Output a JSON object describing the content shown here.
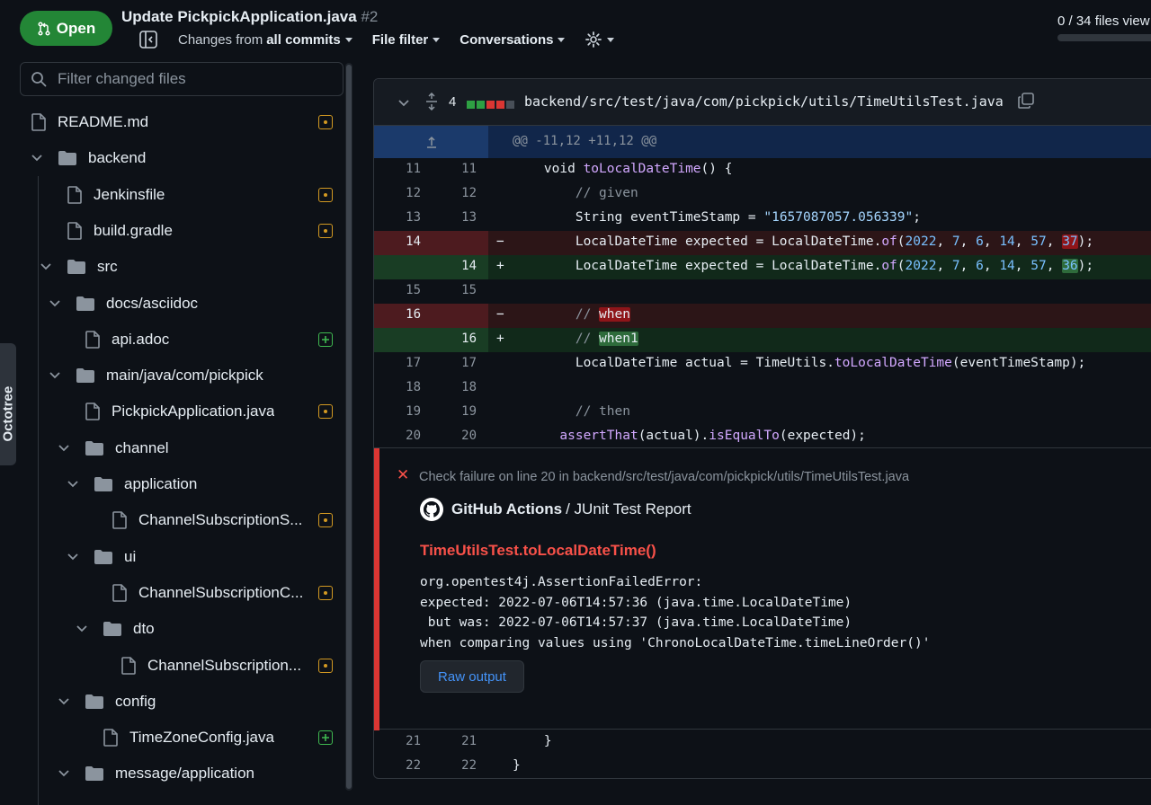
{
  "header": {
    "status": "Open",
    "title": "Update PickpickApplication.java",
    "number": "#2",
    "toolbar": {
      "changes_prefix": "Changes from",
      "changes_value": "all commits",
      "file_filter": "File filter",
      "conversations": "Conversations"
    },
    "files_viewed": "0 / 34 files view",
    "files_viewed_fraction": 0
  },
  "sidebar": {
    "filter_placeholder": "Filter changed files",
    "octotree_label": "Octotree",
    "tree": [
      {
        "name": "README.md",
        "type": "file",
        "status": "modified"
      },
      {
        "name": "backend",
        "type": "folder"
      },
      {
        "name": "Jenkinsfile",
        "type": "file",
        "status": "modified"
      },
      {
        "name": "build.gradle",
        "type": "file",
        "status": "modified"
      },
      {
        "name": "src",
        "type": "folder"
      },
      {
        "name": "docs/asciidoc",
        "type": "folder"
      },
      {
        "name": "api.adoc",
        "type": "file",
        "status": "added"
      },
      {
        "name": "main/java/com/pickpick",
        "type": "folder"
      },
      {
        "name": "PickpickApplication.java",
        "type": "file",
        "status": "modified"
      },
      {
        "name": "channel",
        "type": "folder"
      },
      {
        "name": "application",
        "type": "folder"
      },
      {
        "name": "ChannelSubscriptionS...",
        "type": "file",
        "status": "modified"
      },
      {
        "name": "ui",
        "type": "folder"
      },
      {
        "name": "ChannelSubscriptionC...",
        "type": "file",
        "status": "modified"
      },
      {
        "name": "dto",
        "type": "folder"
      },
      {
        "name": "ChannelSubscription...",
        "type": "file",
        "status": "modified"
      },
      {
        "name": "config",
        "type": "folder"
      },
      {
        "name": "TimeZoneConfig.java",
        "type": "file",
        "status": "added"
      },
      {
        "name": "message/application",
        "type": "folder"
      }
    ]
  },
  "diff": {
    "changes_count": "4",
    "path": "backend/src/test/java/com/pickpick/utils/TimeUtilsTest.java",
    "hunk_header": "@@ -11,12 +11,12 @@",
    "lines": [
      {
        "old": "11",
        "new": "11"
      },
      {
        "old": "12",
        "new": "12"
      },
      {
        "old": "13",
        "new": "13"
      },
      {
        "old": "14",
        "new": "",
        "sign": "−"
      },
      {
        "old": "",
        "new": "14",
        "sign": "+"
      },
      {
        "old": "15",
        "new": "15"
      },
      {
        "old": "16",
        "new": "",
        "sign": "−"
      },
      {
        "old": "",
        "new": "16",
        "sign": "+"
      },
      {
        "old": "17",
        "new": "17"
      },
      {
        "old": "18",
        "new": "18"
      },
      {
        "old": "19",
        "new": "19"
      },
      {
        "old": "20",
        "new": "20"
      },
      {
        "old": "21",
        "new": "21"
      },
      {
        "old": "22",
        "new": "22"
      }
    ],
    "code": {
      "l11_a": "    void ",
      "l11_fn": "toLocalDateTime",
      "l11_b": "() {",
      "l12": "        // given",
      "l13_a": "        String eventTimeStamp = ",
      "l13_str": "\"1657087057.056339\"",
      "l13_b": ";",
      "ld_a": "        LocalDateTime expected = LocalDateTime.",
      "ld_fn": "of",
      "ld_b": "(",
      "n2022": "2022",
      "n7": "7",
      "n6": "6",
      "n14": "14",
      "n57": "57",
      "comma": ", ",
      "del_last": "37",
      "add_last": "36",
      "tail": ");",
      "l16d_a": "        // ",
      "l16d_hl": "when",
      "l16a_a": "        // ",
      "l16a_hl": "when1",
      "l17_a": "        LocalDateTime actual = TimeUtils.",
      "l17_fn": "toLocalDateTime",
      "l17_b": "(eventTimeStamp);",
      "l19": "        // then",
      "l20_a": "      ",
      "l20_fn1": "assertThat",
      "l20_b": "(actual).",
      "l20_fn2": "isEqualTo",
      "l20_c": "(expected);",
      "l21": "    }",
      "l22": "}"
    },
    "annotation": {
      "title": "Check failure on line 20 in backend/src/test/java/com/pickpick/utils/TimeUtilsTest.java",
      "source_bold": "GitHub Actions",
      "source_rest": "/ JUnit Test Report",
      "test_name": "TimeUtilsTest.toLocalDateTime()",
      "message": "org.opentest4j.AssertionFailedError:\nexpected: 2022-07-06T14:57:36 (java.time.LocalDateTime)\n but was: 2022-07-06T14:57:37 (java.time.LocalDateTime)\nwhen comparing values using 'ChronoLocalDateTime.timeLineOrder()'",
      "raw_button": "Raw output"
    }
  }
}
